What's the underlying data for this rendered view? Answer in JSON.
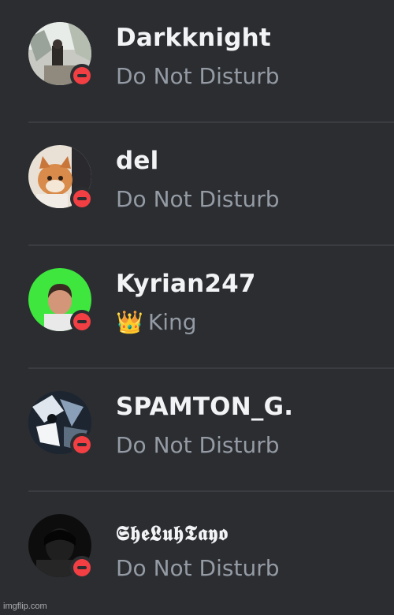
{
  "members": [
    {
      "name": "Darkknight",
      "status": "Do Not Disturb",
      "presence": "dnd"
    },
    {
      "name": "del",
      "status": "Do Not Disturb",
      "presence": "dnd"
    },
    {
      "name": "Kyrian247",
      "status_emoji": "👑",
      "status": "King",
      "presence": "dnd"
    },
    {
      "name": "SPAMTON_G.",
      "status": "Do Not Disturb",
      "presence": "dnd"
    },
    {
      "name": "𝕾𝖍𝖊𝕷𝖚𝖍𝕿𝖆𝖞𝖔",
      "status": "Do Not Disturb",
      "presence": "dnd"
    }
  ],
  "colors": {
    "background": "#2b2d31",
    "name": "#f2f3f5",
    "status_text": "#949ba4",
    "dnd": "#f23f43",
    "kyrian_avatar_bg": "#3ee63e"
  },
  "watermark": "imgflip.com"
}
